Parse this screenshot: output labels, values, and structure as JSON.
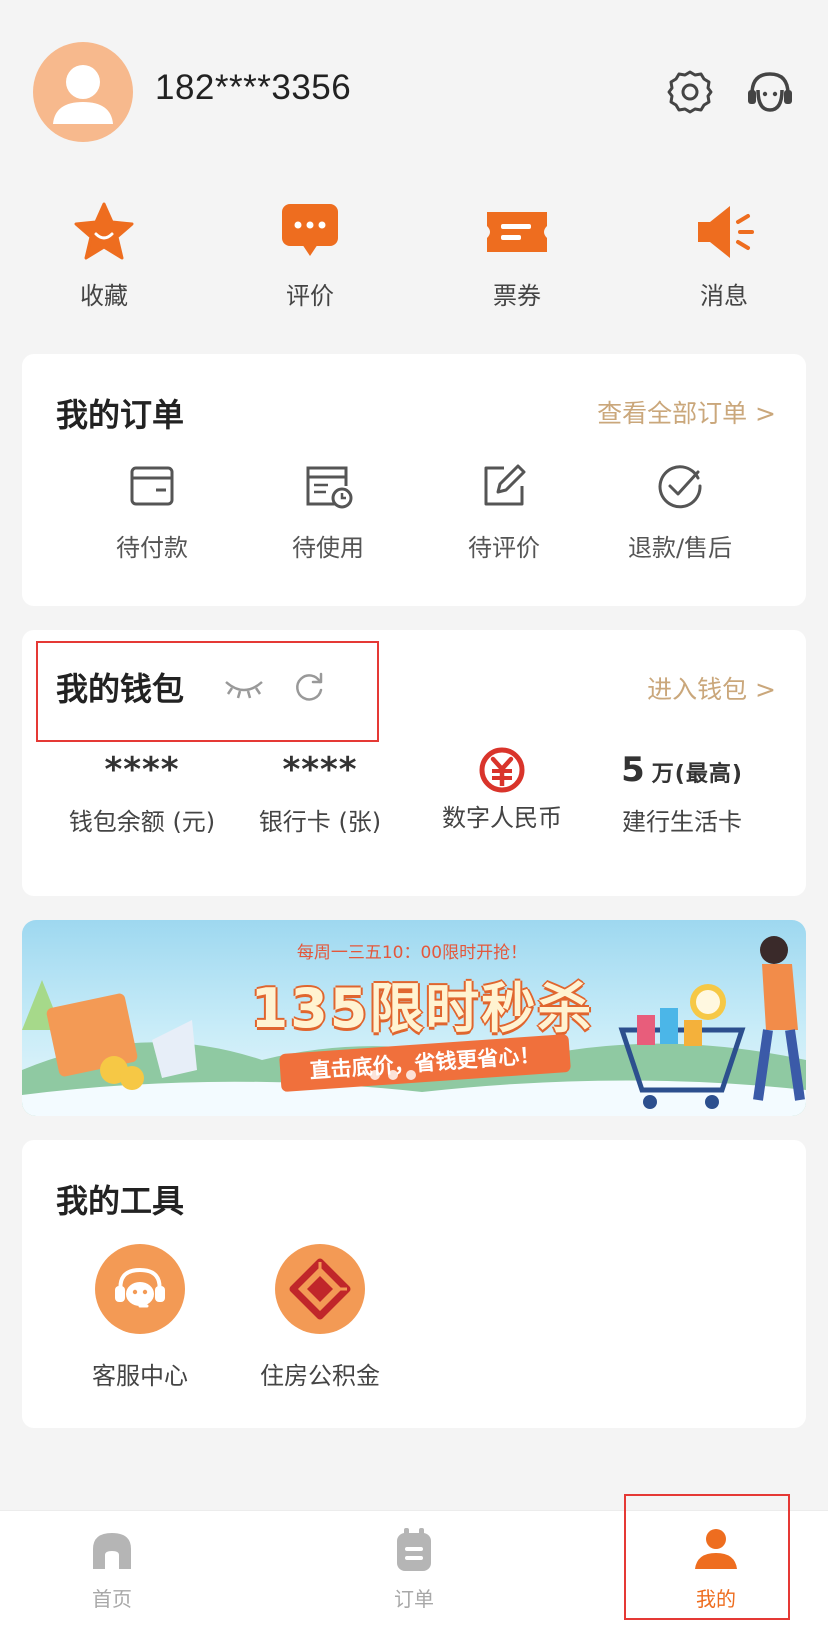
{
  "header": {
    "phone": "182****3356",
    "icons": [
      "avatar-icon",
      "gear-icon",
      "headset-icon"
    ]
  },
  "quick": [
    {
      "label": "收藏",
      "icon": "star-icon"
    },
    {
      "label": "评价",
      "icon": "chat-bubble-icon"
    },
    {
      "label": "票券",
      "icon": "ticket-icon"
    },
    {
      "label": "消息",
      "icon": "speaker-icon"
    }
  ],
  "orders": {
    "title": "我的订单",
    "link": "查看全部订单 >",
    "items": [
      {
        "label": "待付款",
        "icon": "wallet-outline-icon"
      },
      {
        "label": "待使用",
        "icon": "calendar-clock-icon"
      },
      {
        "label": "待评价",
        "icon": "edit-icon"
      },
      {
        "label": "退款/售后",
        "icon": "check-circle-icon"
      }
    ]
  },
  "wallet": {
    "title": "我的钱包",
    "link": "进入钱包 >",
    "items": [
      {
        "value": "****",
        "label": "钱包余额 (元)"
      },
      {
        "value": "****",
        "label": "银行卡 (张)"
      },
      {
        "value": "",
        "label": "数字人民币",
        "icon": "digital-rmb-icon"
      },
      {
        "value": "5",
        "value_unit": "万(最高)",
        "label": "建行生活卡"
      }
    ]
  },
  "banner": {
    "top_text": "每周一三五10：00限时开抢！",
    "title": "135限时秒杀",
    "subtitle": "直击底价，省钱更省心！"
  },
  "tools": {
    "title": "我的工具",
    "items": [
      {
        "label": "客服中心",
        "icon": "customer-service-icon"
      },
      {
        "label": "住房公积金",
        "icon": "housing-fund-icon"
      }
    ]
  },
  "tabbar": {
    "items": [
      {
        "label": "首页",
        "icon": "home-icon",
        "active": false
      },
      {
        "label": "订单",
        "icon": "order-icon",
        "active": false
      },
      {
        "label": "我的",
        "icon": "profile-icon",
        "active": true
      }
    ]
  },
  "colors": {
    "accent": "#ee6d1f",
    "link_gold": "#caa77b",
    "highlight_red": "#e53935",
    "background": "#f4f4f4"
  }
}
